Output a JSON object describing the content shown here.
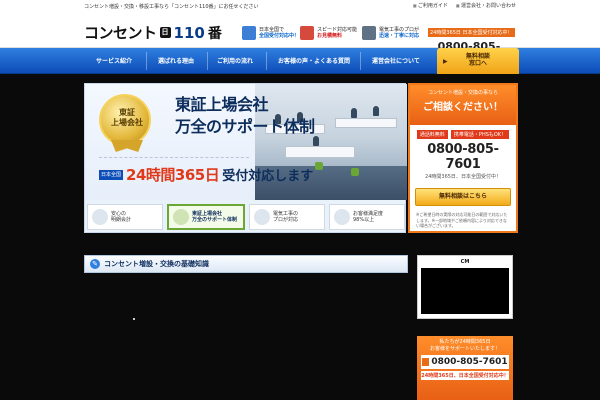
{
  "topbar": {
    "text": "コンセント増設・交換・移設工事なら「コンセント110番」にお任せください",
    "links": [
      "ご利用ガイド",
      "運営会社・お問い合わせ"
    ]
  },
  "header": {
    "logo_word": "コンセント",
    "logo_badge": "日",
    "logo_num": "110",
    "logo_suffix": "番",
    "features": [
      {
        "line1": "日本全国で",
        "line2": "全国受付対応中！",
        "color": "blue"
      },
      {
        "line1": "スピード対応可能",
        "line2": "お見積無料",
        "color": "red"
      },
      {
        "line1": "電気工事のプロが",
        "line2": "迅速・丁寧に対応",
        "color": "blue"
      }
    ],
    "tel_tag": "24時間365日 日本全国受付対応中！",
    "tel_number": "0800-805-7601"
  },
  "nav": {
    "items": [
      "サービス紹介",
      "選ばれる理由",
      "ご利用の流れ",
      "お客様の声・よくある質問",
      "運営会社について"
    ],
    "cta_line1": "無料相談",
    "cta_line2": "窓口へ"
  },
  "hero": {
    "medal_line1": "東証",
    "medal_line2": "上場会社",
    "headline_1": "東証上場会社",
    "headline_2": "万全のサポート体制",
    "hours_tag": "日本全国",
    "hours_big": "24時間365日",
    "hours_rest": "受付対応します",
    "features": [
      {
        "line1": "安心の",
        "line2": "明朗会計",
        "active": false
      },
      {
        "line1": "東証上場会社",
        "line2": "万全のサポート体制",
        "active": true
      },
      {
        "line1": "電気工事の",
        "line2": "プロが対応",
        "active": false
      },
      {
        "line1": "お客様満足度",
        "line2": "98%以上",
        "active": false
      }
    ]
  },
  "sidebar": {
    "intro": "コンセント増設・交換の事なら",
    "headline": "ご相談ください！",
    "tags": [
      "通話料無料",
      "携帯電話・PHSもOK！"
    ],
    "phone": "0800-805-7601",
    "sub": "24時間365日、日本全国受付中！",
    "button": "無料相談はこちら",
    "note": "※ご希望日時の実際の対応可能日の範囲で対応いたします。※一部地域やご依頼内容により対応できない場合がございます。"
  },
  "section": {
    "title": "コンセント増設・交換の基礎知識"
  },
  "cm": {
    "label": "CM"
  },
  "promo": {
    "line1": "私たちが24時間365日",
    "line2": "お客様をサポートいたします！",
    "phone": "0800-805-7601",
    "bar": "24時間365日、日本全国受付対応中！"
  },
  "colors": {
    "nav_blue": "#0d4db8",
    "accent_orange": "#e86015",
    "cta_yellow": "#f2aa1a",
    "accent_red": "#e03a1a"
  }
}
